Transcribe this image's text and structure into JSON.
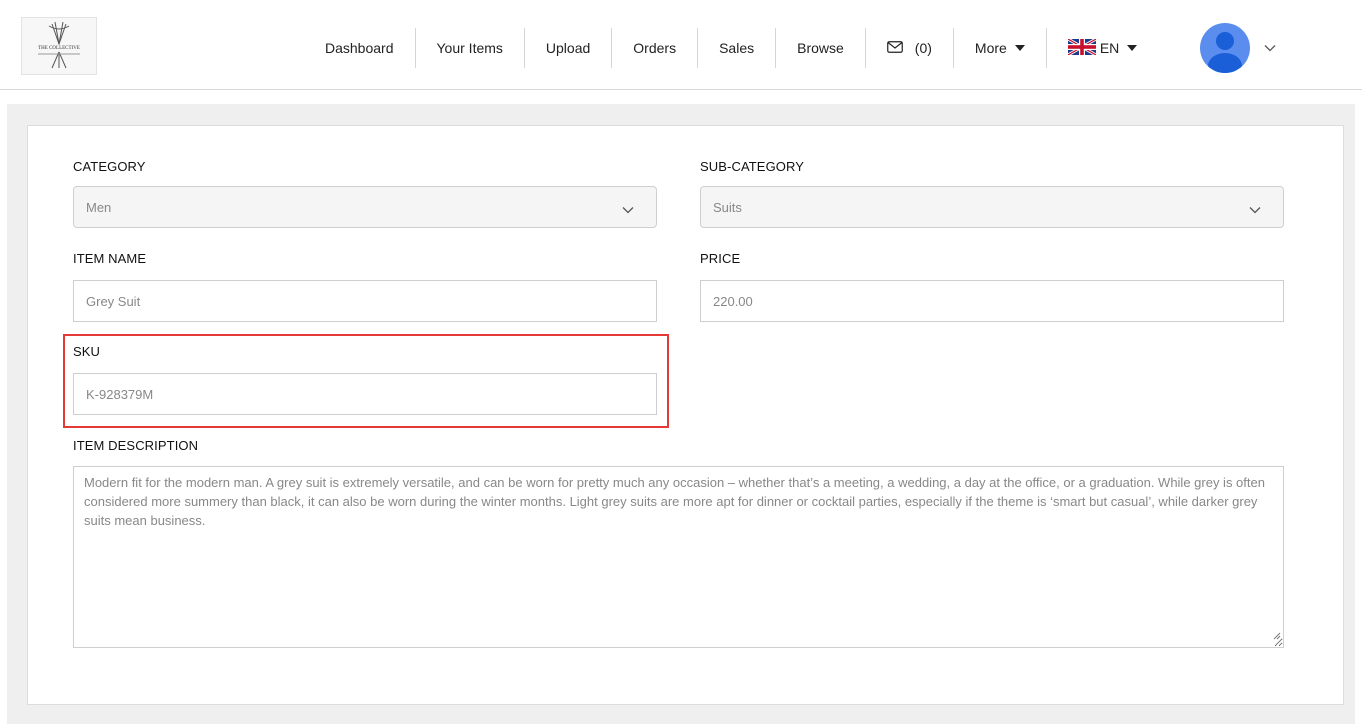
{
  "header": {
    "logo_text": "THE COLLECTIVE",
    "nav": [
      {
        "label": "Dashboard"
      },
      {
        "label": "Your Items"
      },
      {
        "label": "Upload"
      },
      {
        "label": "Orders"
      },
      {
        "label": "Sales"
      },
      {
        "label": "Browse"
      }
    ],
    "messages_count": "(0)",
    "more_label": "More",
    "language_label": "EN"
  },
  "form": {
    "category": {
      "label": "CATEGORY",
      "value": "Men"
    },
    "sub_category": {
      "label": "SUB-CATEGORY",
      "value": "Suits"
    },
    "item_name": {
      "label": "ITEM NAME",
      "value": "Grey Suit"
    },
    "price": {
      "label": "PRICE",
      "value": "220.00"
    },
    "sku": {
      "label": "SKU",
      "value": "K-928379M"
    },
    "item_description": {
      "label": "ITEM DESCRIPTION",
      "value": "Modern fit for the modern man. A grey suit is extremely versatile, and can be worn for pretty much any occasion – whether that’s a meeting, a wedding, a day at the office, or a graduation. While grey is often considered more summery than black, it can also be worn during the winter months. Light grey suits are more apt for dinner or cocktail parties, especially if the theme is ‘smart but casual’, while darker grey suits mean business."
    }
  },
  "colors": {
    "highlight": "#e53935",
    "avatar": "#5b8def",
    "page_background": "#efefef"
  },
  "icons": [
    "mail-icon",
    "uk-flag-icon",
    "caret-down-icon",
    "chevron-down-icon",
    "avatar-icon",
    "resize-grip-icon"
  ]
}
